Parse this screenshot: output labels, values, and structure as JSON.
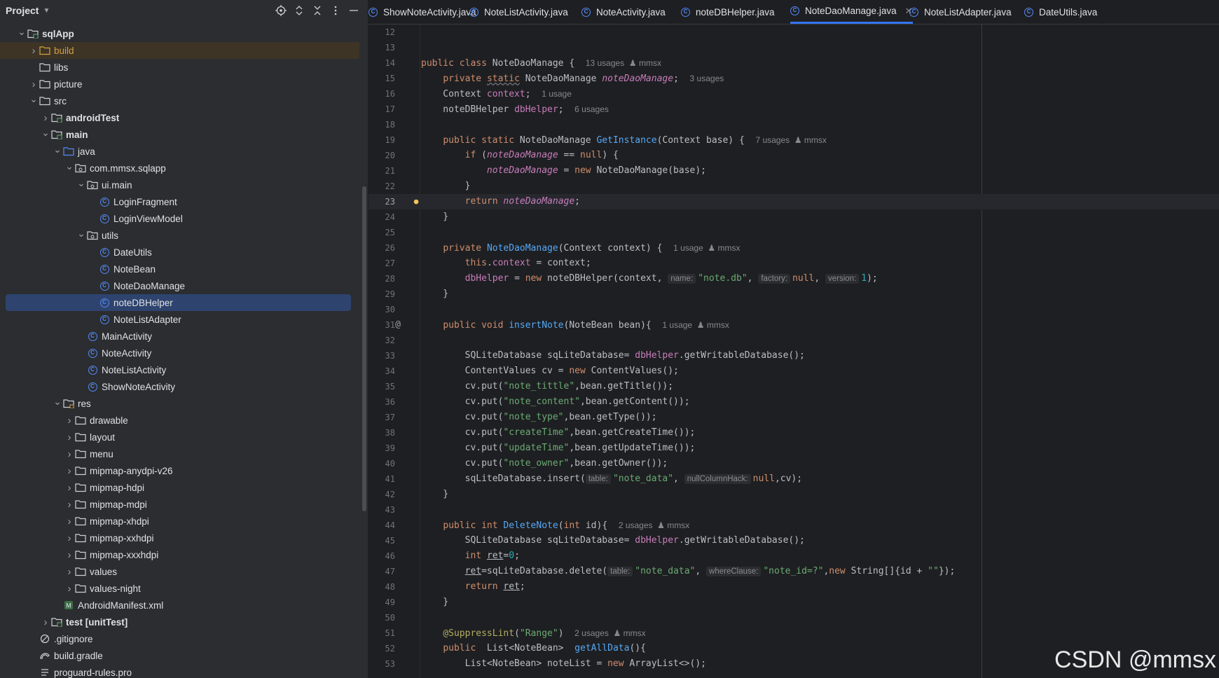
{
  "project_panel": {
    "title": "Project",
    "icons": [
      "locate-icon",
      "expand-all-icon",
      "collapse-all-icon",
      "more-icon",
      "minimize-icon"
    ],
    "tree": [
      {
        "label": "sqlApp",
        "depth": 0,
        "expanded": true,
        "icon": "module-folder-icon",
        "bold": true
      },
      {
        "label": "build",
        "depth": 1,
        "expanded": false,
        "icon": "folder-orange-icon"
      },
      {
        "label": "libs",
        "depth": 1,
        "icon": "folder-icon"
      },
      {
        "label": "picture",
        "depth": 1,
        "expanded": false,
        "icon": "folder-icon"
      },
      {
        "label": "src",
        "depth": 1,
        "expanded": true,
        "icon": "folder-icon"
      },
      {
        "label": "androidTest",
        "depth": 2,
        "expanded": false,
        "icon": "source-folder-icon",
        "bold": true
      },
      {
        "label": "main",
        "depth": 2,
        "expanded": true,
        "icon": "source-folder-icon",
        "bold": true
      },
      {
        "label": "java",
        "depth": 3,
        "expanded": true,
        "icon": "folder-blue-icon"
      },
      {
        "label": "com.mmsx.sqlapp",
        "depth": 4,
        "expanded": true,
        "icon": "package-icon"
      },
      {
        "label": "ui.main",
        "depth": 5,
        "expanded": true,
        "icon": "package-icon"
      },
      {
        "label": "LoginFragment",
        "depth": 6,
        "icon": "class-icon"
      },
      {
        "label": "LoginViewModel",
        "depth": 6,
        "icon": "class-icon"
      },
      {
        "label": "utils",
        "depth": 5,
        "expanded": true,
        "icon": "package-icon"
      },
      {
        "label": "DateUtils",
        "depth": 6,
        "icon": "class-icon"
      },
      {
        "label": "NoteBean",
        "depth": 6,
        "icon": "class-icon"
      },
      {
        "label": "NoteDaoManage",
        "depth": 6,
        "icon": "class-icon"
      },
      {
        "label": "noteDBHelper",
        "depth": 6,
        "icon": "class-icon",
        "selected": true
      },
      {
        "label": "NoteListAdapter",
        "depth": 6,
        "icon": "class-icon"
      },
      {
        "label": "MainActivity",
        "depth": 5,
        "icon": "class-icon"
      },
      {
        "label": "NoteActivity",
        "depth": 5,
        "icon": "class-icon"
      },
      {
        "label": "NoteListActivity",
        "depth": 5,
        "icon": "class-icon"
      },
      {
        "label": "ShowNoteActivity",
        "depth": 5,
        "icon": "class-icon"
      },
      {
        "label": "res",
        "depth": 3,
        "expanded": true,
        "icon": "resource-folder-icon"
      },
      {
        "label": "drawable",
        "depth": 4,
        "expanded": false,
        "icon": "folder-icon"
      },
      {
        "label": "layout",
        "depth": 4,
        "expanded": false,
        "icon": "folder-icon"
      },
      {
        "label": "menu",
        "depth": 4,
        "expanded": false,
        "icon": "folder-icon"
      },
      {
        "label": "mipmap-anydpi-v26",
        "depth": 4,
        "expanded": false,
        "icon": "folder-icon"
      },
      {
        "label": "mipmap-hdpi",
        "depth": 4,
        "expanded": false,
        "icon": "folder-icon"
      },
      {
        "label": "mipmap-mdpi",
        "depth": 4,
        "expanded": false,
        "icon": "folder-icon"
      },
      {
        "label": "mipmap-xhdpi",
        "depth": 4,
        "expanded": false,
        "icon": "folder-icon"
      },
      {
        "label": "mipmap-xxhdpi",
        "depth": 4,
        "expanded": false,
        "icon": "folder-icon"
      },
      {
        "label": "mipmap-xxxhdpi",
        "depth": 4,
        "expanded": false,
        "icon": "folder-icon"
      },
      {
        "label": "values",
        "depth": 4,
        "expanded": false,
        "icon": "folder-icon"
      },
      {
        "label": "values-night",
        "depth": 4,
        "expanded": false,
        "icon": "folder-icon"
      },
      {
        "label": "AndroidManifest.xml",
        "depth": 3,
        "icon": "manifest-icon"
      },
      {
        "label": "test [unitTest]",
        "depth": 2,
        "expanded": false,
        "icon": "source-folder-icon",
        "bold": true
      },
      {
        "label": ".gitignore",
        "depth": 1,
        "icon": "gitignore-icon"
      },
      {
        "label": "build.gradle",
        "depth": 1,
        "icon": "gradle-icon"
      },
      {
        "label": "proguard-rules.pro",
        "depth": 1,
        "icon": "text-file-icon"
      }
    ]
  },
  "tabs": [
    {
      "label": "ShowNoteActivity.java"
    },
    {
      "label": "NoteListActivity.java"
    },
    {
      "label": "NoteActivity.java"
    },
    {
      "label": "noteDBHelper.java"
    },
    {
      "label": "NoteDaoManage.java",
      "active": true
    },
    {
      "label": "NoteListAdapter.java"
    },
    {
      "label": "DateUtils.java"
    }
  ],
  "editor": {
    "current_line": 23,
    "lines": [
      {
        "n": 12,
        "html": ""
      },
      {
        "n": 13,
        "html": ""
      },
      {
        "n": 14,
        "html": "<span class='kw'>public class</span> NoteDaoManage {  <span class='hint'>13 usages  ♟ mmsx</span>"
      },
      {
        "n": 15,
        "html": "    <span class='kw'>private</span> <span class='kw wv'>static</span> NoteDaoManage <span class='sfld'>noteDaoManage</span>;  <span class='hint'>3 usages</span>"
      },
      {
        "n": 16,
        "html": "    Context <span class='fld'>context</span>;  <span class='hint'>1 usage</span>"
      },
      {
        "n": 17,
        "html": "    noteDBHelper <span class='fld'>dbHelper</span>;  <span class='hint'>6 usages</span>"
      },
      {
        "n": 18,
        "html": ""
      },
      {
        "n": 19,
        "html": "    <span class='kw'>public static</span> NoteDaoManage <span class='fn'>GetInstance</span>(Context base) {  <span class='hint'>7 usages  ♟ mmsx</span>"
      },
      {
        "n": 20,
        "html": "        <span class='kw'>if</span> (<span class='sfld'>noteDaoManage</span> == <span class='kw'>null</span>) {"
      },
      {
        "n": 21,
        "html": "            <span class='sfld'>noteDaoManage</span> = <span class='kw'>new</span> NoteDaoManage(base);"
      },
      {
        "n": 22,
        "html": "        }"
      },
      {
        "n": 23,
        "html": "        <span class='kw'>return</span> <span class='sfld'>noteDaoManage</span>;"
      },
      {
        "n": 24,
        "html": "    }"
      },
      {
        "n": 25,
        "html": ""
      },
      {
        "n": 26,
        "html": "    <span class='kw'>private</span> <span class='fn'>NoteDaoManage</span>(Context context) {  <span class='hint'>1 usage  ♟ mmsx</span>"
      },
      {
        "n": 27,
        "html": "        <span class='kw'>this</span>.<span class='fld'>context</span> = context;"
      },
      {
        "n": 28,
        "html": "        <span class='fld'>dbHelper</span> = <span class='kw'>new</span> noteDBHelper(context, <span class='ph'>name:</span><span class='str'>\"note.db\"</span>, <span class='ph'>factory:</span><span class='kw'>null</span>, <span class='ph'>version:</span><span class='num'>1</span>);"
      },
      {
        "n": 29,
        "html": "    }"
      },
      {
        "n": 30,
        "html": ""
      },
      {
        "n": 31,
        "html": "    <span class='kw'>public void</span> <span class='fn'>insertNote</span>(NoteBean bean){  <span class='hint'>1 usage  ♟ mmsx</span>"
      },
      {
        "n": 32,
        "html": ""
      },
      {
        "n": 33,
        "html": "        SQLiteDatabase sqLiteDatabase= <span class='fld'>dbHelper</span>.getWritableDatabase();"
      },
      {
        "n": 34,
        "html": "        ContentValues cv = <span class='kw'>new</span> ContentValues();"
      },
      {
        "n": 35,
        "html": "        cv.put(<span class='str'>\"note_tittle\"</span>,bean.getTitle());"
      },
      {
        "n": 36,
        "html": "        cv.put(<span class='str'>\"note_content\"</span>,bean.getContent());"
      },
      {
        "n": 37,
        "html": "        cv.put(<span class='str'>\"note_type\"</span>,bean.getType());"
      },
      {
        "n": 38,
        "html": "        cv.put(<span class='str'>\"createTime\"</span>,bean.getCreateTime());"
      },
      {
        "n": 39,
        "html": "        cv.put(<span class='str'>\"updateTime\"</span>,bean.getUpdateTime());"
      },
      {
        "n": 40,
        "html": "        cv.put(<span class='str'>\"note_owner\"</span>,bean.getOwner());"
      },
      {
        "n": 41,
        "html": "        sqLiteDatabase.insert(<span class='ph'>table:</span><span class='str'>\"note_data\"</span>, <span class='ph'>nullColumnHack:</span><span class='kw'>null</span>,cv);"
      },
      {
        "n": 42,
        "html": "    }"
      },
      {
        "n": 43,
        "html": ""
      },
      {
        "n": 44,
        "html": "    <span class='kw'>public int</span> <span class='fn'>DeleteNote</span>(<span class='kw'>int</span> id){  <span class='hint'>2 usages  ♟ mmsx</span>"
      },
      {
        "n": 45,
        "html": "        SQLiteDatabase sqLiteDatabase= <span class='fld'>dbHelper</span>.getWritableDatabase();"
      },
      {
        "n": 46,
        "html": "        <span class='kw'>int</span> <span class='ul'>ret</span>=<span class='num'>0</span>;"
      },
      {
        "n": 47,
        "html": "        <span class='ul'>ret</span>=sqLiteDatabase.delete(<span class='ph'>table:</span><span class='str'>\"note_data\"</span>, <span class='ph'>whereClause:</span><span class='str'>\"note_id=?\"</span>,<span class='kw'>new</span> String[]{id + <span class='str'>\"\"</span>});"
      },
      {
        "n": 48,
        "html": "        <span class='kw'>return</span> <span class='ul'>ret</span>;"
      },
      {
        "n": 49,
        "html": "    }"
      },
      {
        "n": 50,
        "html": ""
      },
      {
        "n": 51,
        "html": "    <span class='ann'>@SuppressLint</span>(<span class='str'>\"Range\"</span>)  <span class='hint'>2 usages  ♟ mmsx</span>"
      },
      {
        "n": 52,
        "html": "    <span class='kw'>public</span>  List&lt;NoteBean&gt;  <span class='fn'>getAllData</span>(){"
      },
      {
        "n": 53,
        "html": "        List&lt;NoteBean&gt; noteList = <span class='kw'>new</span> ArrayList&lt;&gt;();"
      }
    ],
    "gutter_marks": {
      "23": "bulb-icon",
      "31": "implements-icon"
    }
  },
  "watermark": "CSDN @mmsx",
  "colors": {
    "accent": "#3574f0",
    "selection": "#2e436e",
    "keyword": "#cf8e6d",
    "string": "#6aab73",
    "function": "#56a8f5",
    "field": "#c77dbb"
  }
}
